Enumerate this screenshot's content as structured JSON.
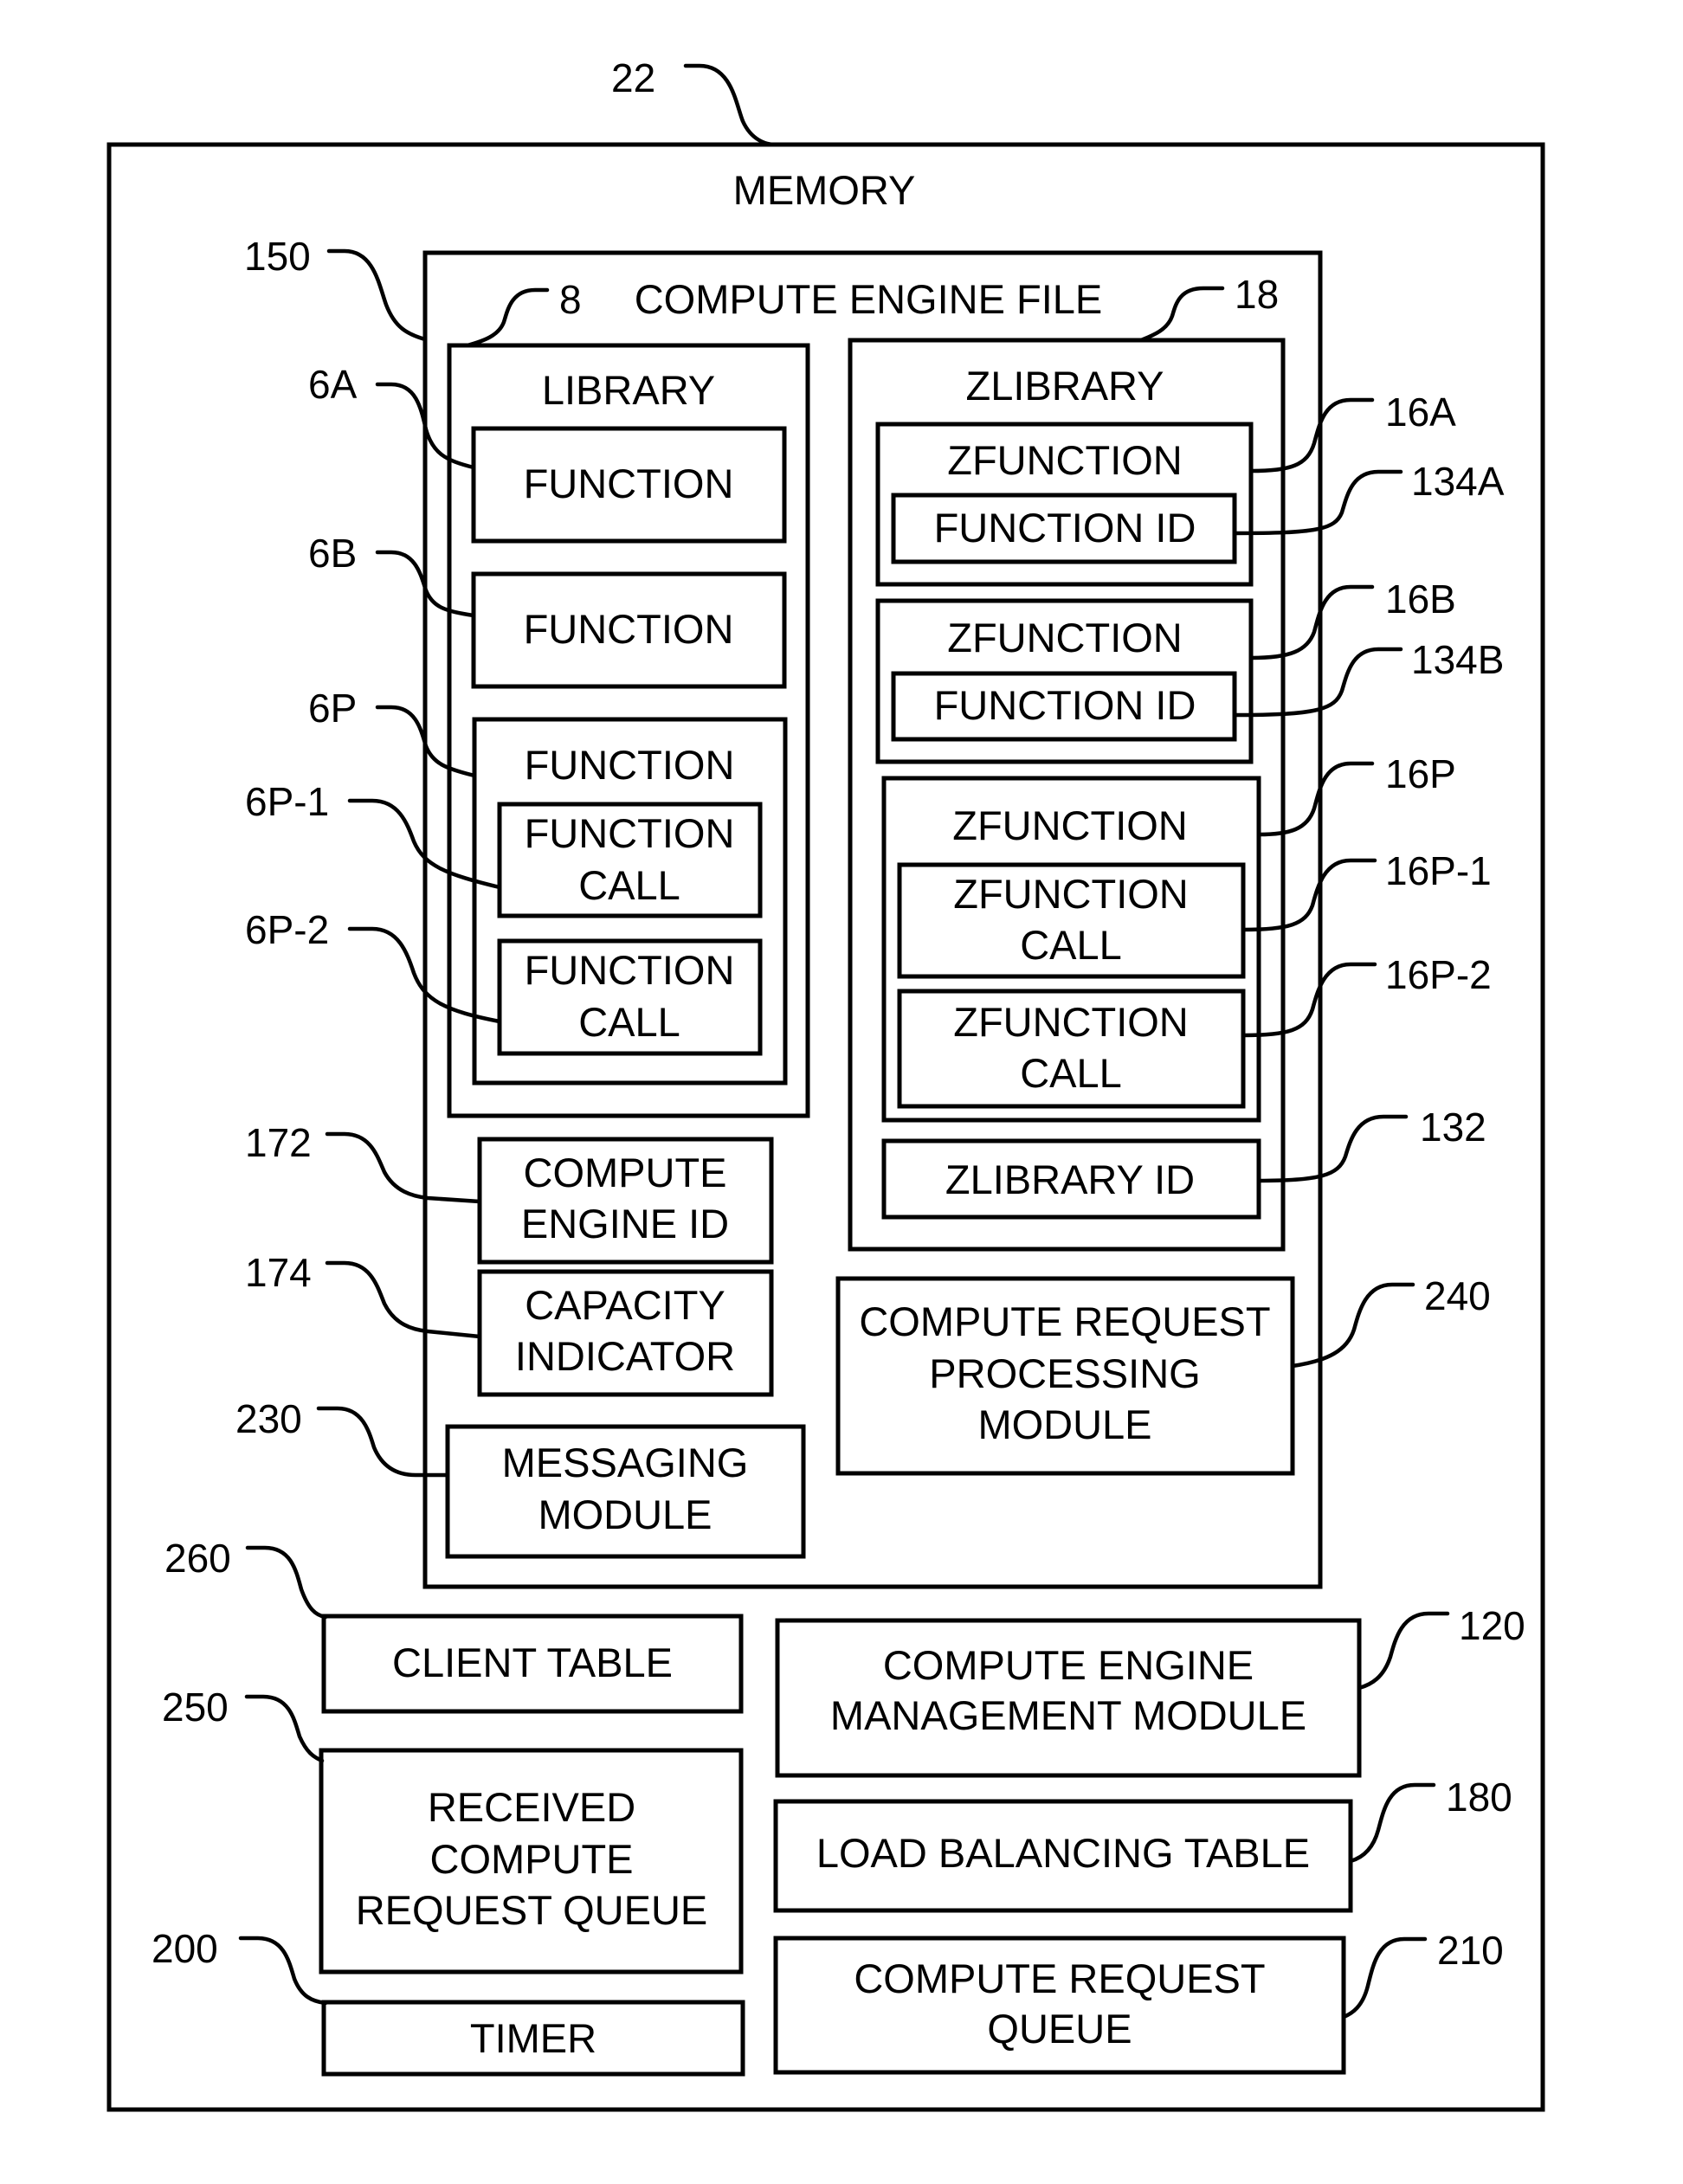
{
  "figure": {
    "memory": {
      "ref": "22",
      "title": "MEMORY"
    },
    "compute_engine_file": {
      "ref": "150",
      "title": "COMPUTE ENGINE FILE",
      "library": {
        "ref": "8",
        "title": "LIBRARY",
        "functions": [
          {
            "ref": "6A",
            "label": "FUNCTION"
          },
          {
            "ref": "6B",
            "label": "FUNCTION"
          },
          {
            "ref": "6P",
            "label": "FUNCTION",
            "calls": [
              {
                "ref": "6P-1",
                "line1": "FUNCTION",
                "line2": "CALL"
              },
              {
                "ref": "6P-2",
                "line1": "FUNCTION",
                "line2": "CALL"
              }
            ]
          }
        ]
      },
      "zlibrary": {
        "ref": "18",
        "title": "ZLIBRARY",
        "zfunctions": [
          {
            "ref": "16A",
            "label": "ZFUNCTION",
            "id_ref": "134A",
            "id_label": "FUNCTION ID"
          },
          {
            "ref": "16B",
            "label": "ZFUNCTION",
            "id_ref": "134B",
            "id_label": "FUNCTION ID"
          },
          {
            "ref": "16P",
            "label": "ZFUNCTION",
            "calls": [
              {
                "ref": "16P-1",
                "line1": "ZFUNCTION",
                "line2": "CALL"
              },
              {
                "ref": "16P-2",
                "line1": "ZFUNCTION",
                "line2": "CALL"
              }
            ]
          }
        ],
        "zlibrary_id": {
          "ref": "132",
          "label": "ZLIBRARY ID"
        }
      },
      "compute_engine_id": {
        "ref": "172",
        "line1": "COMPUTE",
        "line2": "ENGINE ID"
      },
      "capacity_indicator": {
        "ref": "174",
        "line1": "CAPACITY",
        "line2": "INDICATOR"
      },
      "messaging_module": {
        "ref": "230",
        "line1": "MESSAGING",
        "line2": "MODULE"
      },
      "compute_request_processing_module": {
        "ref": "240",
        "line1": "COMPUTE REQUEST",
        "line2": "PROCESSING",
        "line3": "MODULE"
      }
    },
    "client_table": {
      "ref": "260",
      "label": "CLIENT TABLE"
    },
    "received_compute_request_queue": {
      "ref": "250",
      "line1": "RECEIVED",
      "line2": "COMPUTE",
      "line3": "REQUEST QUEUE"
    },
    "timer": {
      "ref": "200",
      "label": "TIMER"
    },
    "compute_engine_management_module": {
      "ref": "120",
      "line1": "COMPUTE ENGINE",
      "line2": "MANAGEMENT MODULE"
    },
    "load_balancing_table": {
      "ref": "180",
      "label": "LOAD BALANCING TABLE"
    },
    "compute_request_queue": {
      "ref": "210",
      "line1": "COMPUTE REQUEST",
      "line2": "QUEUE"
    }
  }
}
